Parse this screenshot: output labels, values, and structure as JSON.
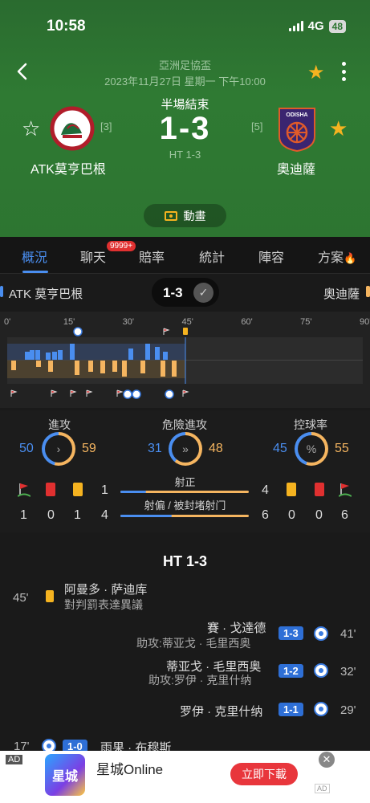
{
  "status_bar": {
    "time": "10:58",
    "network": "4G",
    "battery": "48"
  },
  "match": {
    "league": "亞洲足協盃",
    "datetime": "2023年11月27日 星期一 下午10:00",
    "status": "半場結束",
    "score": "1-3",
    "halftime": "HT 1-3",
    "home": {
      "name": "ATK莫亨巴根",
      "rank": "[3]",
      "short_name": "ATK 莫亨巴根"
    },
    "away": {
      "name": "奧迪薩",
      "rank": "[5]",
      "logo_text": "ODISHA"
    },
    "animation_label": "動畫"
  },
  "tabs": [
    {
      "label": "概況",
      "active": true
    },
    {
      "label": "聊天"
    },
    {
      "label": "賠率"
    },
    {
      "label": "統計"
    },
    {
      "label": "陣容"
    },
    {
      "label": "方案"
    }
  ],
  "chat_badge": "9999+",
  "scorebar": {
    "score": "1-3"
  },
  "timeline": {
    "ticks": [
      "0'",
      "15'",
      "30'",
      "45'",
      "60'",
      "75'",
      "90'"
    ],
    "current_minute": 45
  },
  "stats": {
    "attack": {
      "label": "進攻",
      "home": "50",
      "away": "59",
      "icon": "chevron-right-icon"
    },
    "dangerous": {
      "label": "危險進攻",
      "home": "31",
      "away": "48",
      "icon": "triple-chevron-icon"
    },
    "possession": {
      "label": "控球率",
      "home": "45",
      "away": "55",
      "icon": "percent-icon"
    },
    "home_counts": {
      "corners": "1",
      "red": "0",
      "yellow": "1"
    },
    "away_counts": {
      "yellow": "0",
      "red": "0",
      "corners": "6"
    },
    "shots_on": {
      "label": "射正",
      "home": "1",
      "away": "4"
    },
    "shots_off": {
      "label": "射偏 / 被封堵射门",
      "home": "4",
      "away": "6"
    }
  },
  "events": {
    "section_title": "HT 1-3",
    "items": [
      {
        "minute": "45'",
        "player": "阿曼多 · 萨迪库",
        "note": "對判罰表達異議",
        "type": "yellow-card",
        "side": "home"
      },
      {
        "minute": "41'",
        "player": "賽 · 戈達德",
        "note": "助攻:蒂亚戈 · 毛里西奥",
        "score": "1-3",
        "type": "goal",
        "side": "away"
      },
      {
        "minute": "32'",
        "player": "蒂亚戈 · 毛里西奥",
        "note": "助攻:罗伊 · 克里什纳",
        "score": "1-2",
        "type": "goal",
        "side": "away"
      },
      {
        "minute": "29'",
        "player": "罗伊 · 克里什纳",
        "score": "1-1",
        "type": "goal",
        "side": "away"
      },
      {
        "minute": "17'",
        "player": "雨果 · 布穆斯",
        "score": "1-0",
        "type": "goal",
        "side": "home"
      }
    ]
  },
  "ad": {
    "label": "AD",
    "title": "星城Online",
    "button": "立即下載",
    "mark": "AD",
    "thumb_text": "星城"
  },
  "colors": {
    "home": "#4a8ef0",
    "away": "#f5b560",
    "header_green": "#2f7a33"
  }
}
